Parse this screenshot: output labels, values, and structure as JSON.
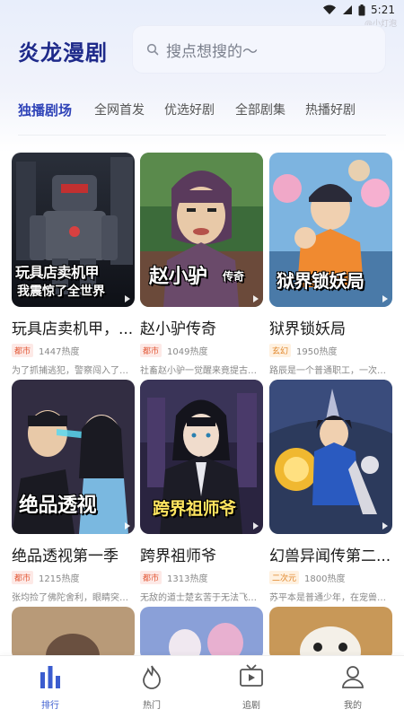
{
  "status_bar": {
    "time": "5:21",
    "watermark": "@小灯泡"
  },
  "app": {
    "logo": "炎龙漫剧"
  },
  "search": {
    "placeholder": "搜点想搜的～"
  },
  "tabs": [
    {
      "label": "独播剧场",
      "active": true
    },
    {
      "label": "全网首发",
      "active": false
    },
    {
      "label": "优选好剧",
      "active": false
    },
    {
      "label": "全部剧集",
      "active": false
    },
    {
      "label": "热播好剧",
      "active": false
    }
  ],
  "cards": [
    {
      "title": "玩具店卖机甲，...",
      "tag": "都市",
      "heat": "1447热度",
      "desc": "为了抓捕逃犯，警察闯入了一...",
      "cover_caption": "玩具店卖机甲",
      "cover_caption2": "我震惊了全世界"
    },
    {
      "title": "赵小驴传奇",
      "tag": "都市",
      "heat": "1049热度",
      "desc": "社畜赵小驴一觉醒来竟提古代...",
      "cover_caption": "赵小驴",
      "cover_caption2": "传奇"
    },
    {
      "title": "狱界锁妖局",
      "tag": "玄幻",
      "heat": "1950热度",
      "desc": "路辰是一个普通职工，一次深...",
      "cover_caption": "狱界锁妖局",
      "cover_caption2": ""
    },
    {
      "title": "绝品透视第一季",
      "tag": "都市",
      "heat": "1215热度",
      "desc": "张均捡了佛陀舍利，眼睛突然...",
      "cover_caption": "绝品透视",
      "cover_caption2": ""
    },
    {
      "title": "跨界祖师爷",
      "tag": "都市",
      "heat": "1313热度",
      "desc": "无敌的道士楚玄苦于无法飞升...",
      "cover_caption": "跨界祖师爷",
      "cover_caption2": ""
    },
    {
      "title": "幻兽异闻传第二...",
      "tag": "二次元",
      "heat": "1800热度",
      "desc": "苏平本是普通少年，在宠兽时...",
      "cover_caption": "",
      "cover_caption2": ""
    }
  ],
  "nav": [
    {
      "label": "排行",
      "icon": "chart-bars-icon",
      "active": true
    },
    {
      "label": "热门",
      "icon": "flame-icon",
      "active": false
    },
    {
      "label": "追剧",
      "icon": "tv-icon",
      "active": false
    },
    {
      "label": "我的",
      "icon": "user-icon",
      "active": false
    }
  ],
  "colors": {
    "accent": "#2f43b8",
    "logo": "#1e2a8a",
    "tag_red": "#e35b3a"
  }
}
